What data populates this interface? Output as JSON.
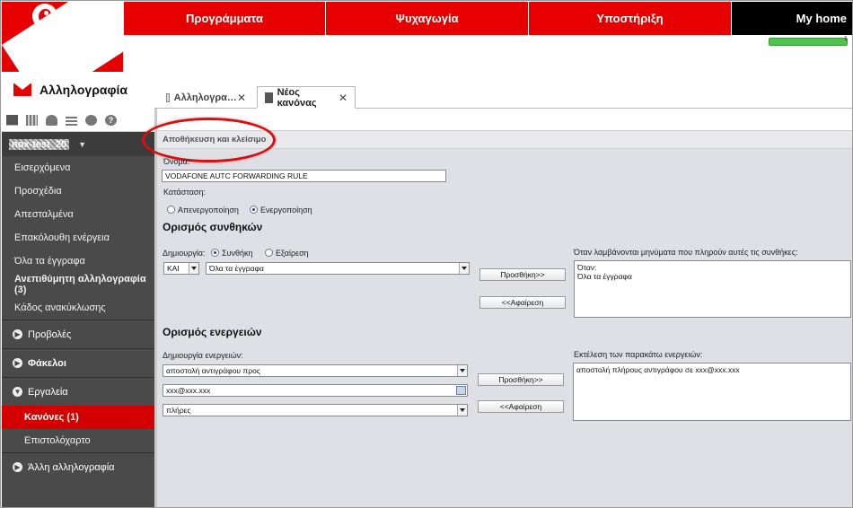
{
  "topnav": {
    "programs": "Προγράμματα",
    "entertainment": "Ψυχαγωγία",
    "support": "Υποστήριξη",
    "myhome": "My home"
  },
  "quota": {
    "label": "1",
    "fraction": 1.0,
    "color": "#4ec44e"
  },
  "app": {
    "title": "Αλληλογραφία"
  },
  "tabs": [
    {
      "label": "Αλληλογρα…",
      "close": "✕"
    },
    {
      "label": "Νέος κανόνας",
      "close": "✕"
    }
  ],
  "sidebar": {
    "account": "nox-test_20",
    "folders": [
      "Εισερχόμενα",
      "Προσχέδια",
      "Απεσταλμένα",
      "Επακόλουθη ενέργεια",
      "Όλα τα έγγραφα",
      "Ανεπιθύμητη αλληλογραφία (3)",
      "Κάδος ανακύκλωσης"
    ],
    "views": "Προβολές",
    "folders_section": "Φάκελοι",
    "tools": "Εργαλεία",
    "rules": "Κανόνες (1)",
    "stationery": "Επιστολόχαρτο",
    "other_mail": "Άλλη αλληλογραφία"
  },
  "form": {
    "save_close": "Αποθήκευση και κλείσιμο",
    "name_label": "Όνομα:",
    "name_value": "VODAFONE AUTC FORWARDING RULE",
    "state_label": "Κατάσταση:",
    "disable": "Απενεργοποίηση",
    "enable": "Ενεργοποίηση",
    "conditions_title": "Ορισμός συνθηκών",
    "create_label": "Δημιουργία:",
    "condition": "Συνθήκη",
    "exception": "Εξαίρεση",
    "and_value": "ΚΑΙ",
    "scope_value": "Όλα τα έγγραφα",
    "add": "Προσθήκη>>",
    "remove": "<<Αφαίρεση",
    "conditions_result_label": "Όταν λαμβάνονται μηνύματα που πληρούν αυτές τις συνθήκες:",
    "conditions_result_lines": [
      "Όταν:",
      "Όλα τα έγγραφα"
    ],
    "actions_title": "Ορισμός ενεργειών",
    "actions_create_label": "Δημιουργία ενεργειών:",
    "action_value": "αποστολή αντιγράφου προς",
    "email_value": "xxx@xxx.xxx",
    "mode_value": "πλήρες",
    "actions_result_label": "Εκτέλεση των παρακάτω ενεργειών:",
    "actions_result_line": "αποστολή πλήρους αντιγράφου σε xxx@xxx.xxx"
  },
  "colors": {
    "brand_red": "#e60000",
    "sidebar_bg": "#4a4a4a",
    "active_item": "#d40000",
    "highlight_ellipse": "#d41010"
  }
}
